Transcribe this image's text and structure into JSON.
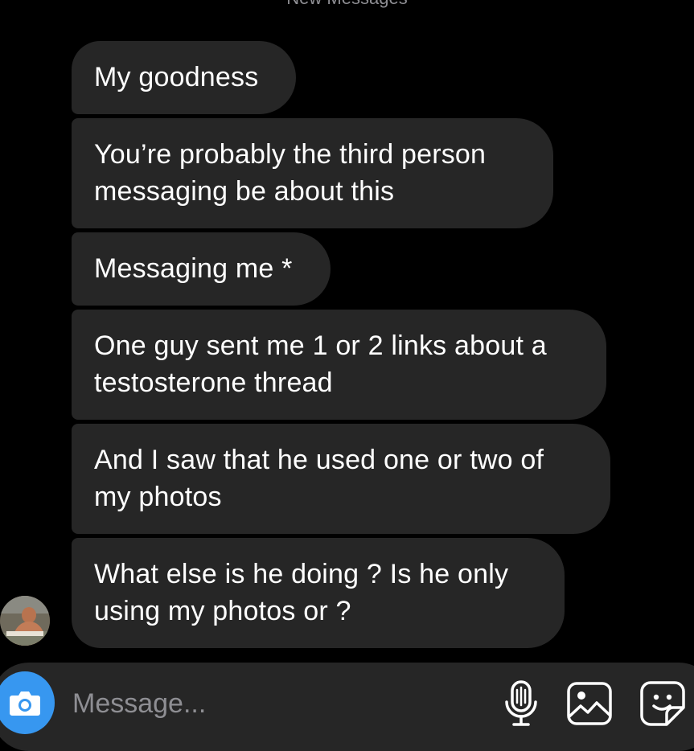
{
  "thread": {
    "divider_label": "New Messages"
  },
  "messages": [
    {
      "text": "My goodness"
    },
    {
      "text": "You’re probably the third person\nmessaging be about this"
    },
    {
      "text": "Messaging me *"
    },
    {
      "text": "One guy sent me 1 or 2 links about a\ntestosterone thread"
    },
    {
      "text": "And I saw that he used one or two of\nmy photos"
    },
    {
      "text": "What else is he doing ? Is he only\nusing my photos or ?"
    }
  ],
  "composer": {
    "placeholder": "Message...",
    "value": ""
  },
  "icons": {
    "camera": "camera-icon",
    "microphone": "microphone-icon",
    "gallery": "gallery-icon",
    "sticker": "sticker-icon"
  },
  "colors": {
    "background": "#000000",
    "bubble": "#262626",
    "accent": "#3797f0",
    "placeholder": "#8e8e93"
  }
}
